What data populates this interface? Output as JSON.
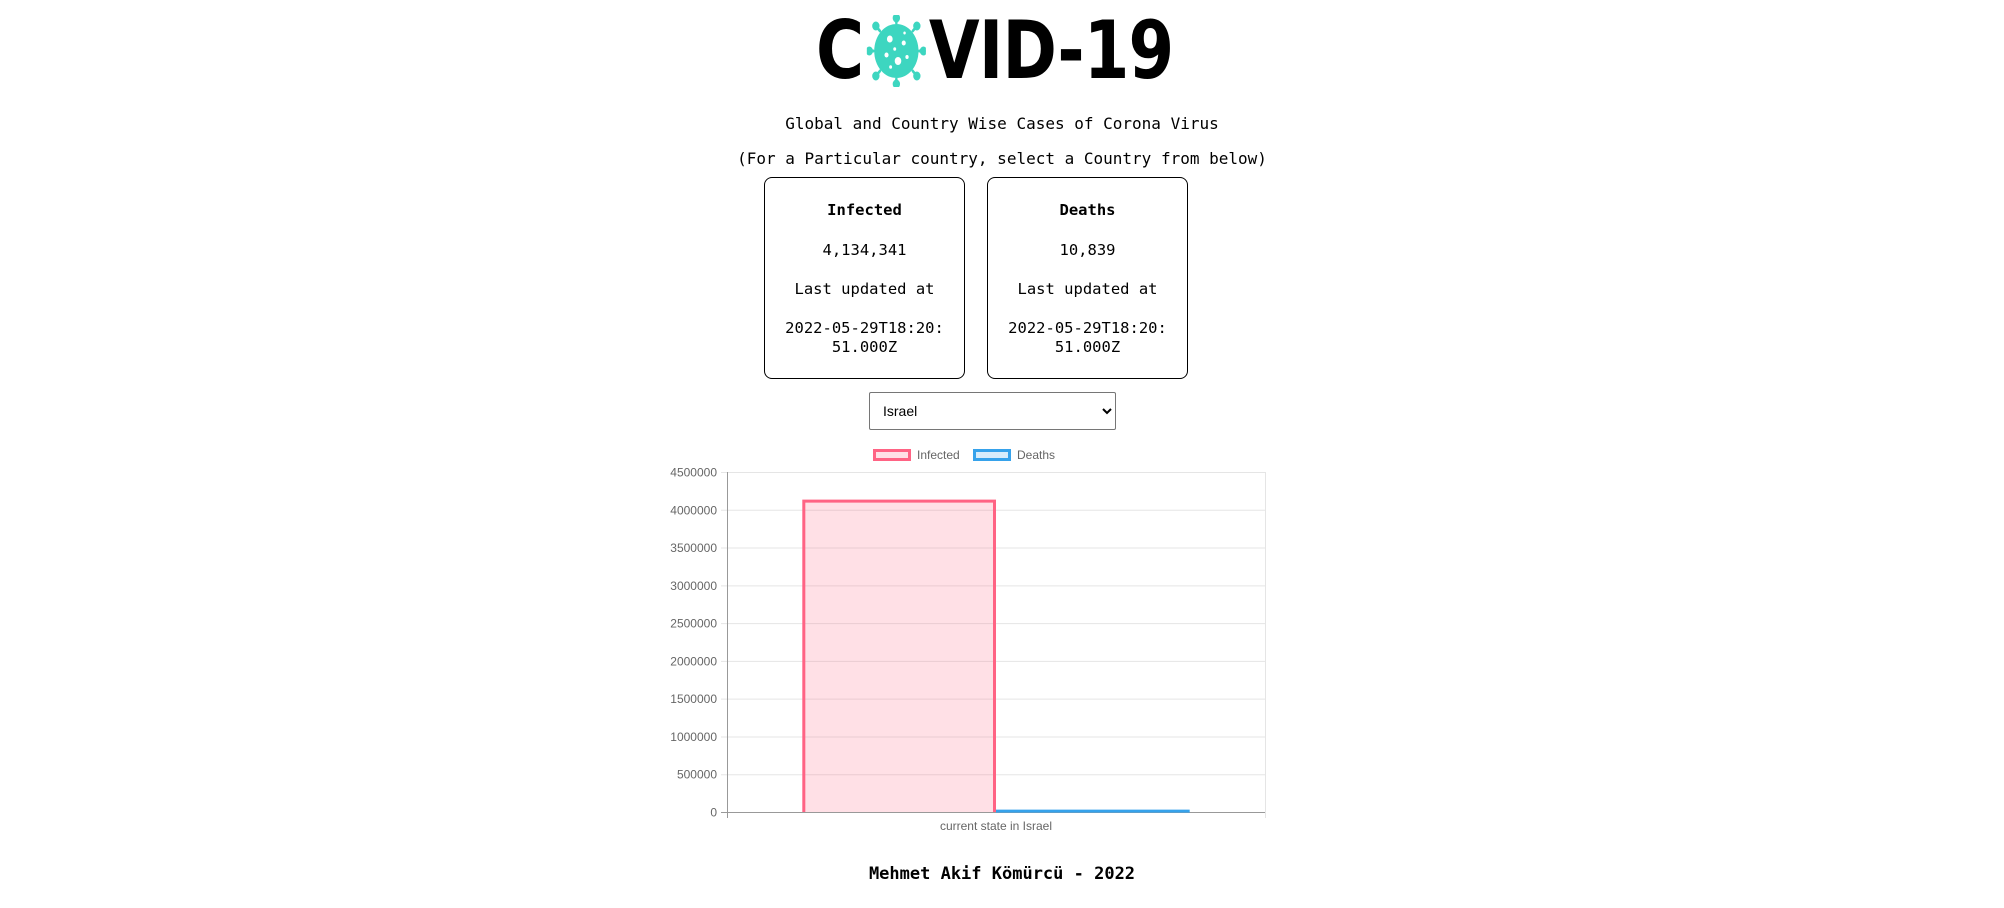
{
  "header": {
    "logo_left": "C",
    "logo_right": "VID-19",
    "subtitle": "Global and Country Wise Cases of Corona Virus",
    "instruction": "(For a Particular country, select a Country from below)"
  },
  "cards": [
    {
      "title": "Infected",
      "value": "4,134,341",
      "label": "Last updated at",
      "date": "2022-05-29T18:20:51.000Z"
    },
    {
      "title": "Deaths",
      "value": "10,839",
      "label": "Last updated at",
      "date": "2022-05-29T18:20:51.000Z"
    }
  ],
  "country_select": {
    "selected": "Israel"
  },
  "chart_data": {
    "type": "bar",
    "categories": [
      "current state in Israel"
    ],
    "series": [
      {
        "name": "Infected",
        "values": [
          4134341
        ],
        "color": "#ff6384"
      },
      {
        "name": "Deaths",
        "values": [
          10839
        ],
        "color": "#36a2eb"
      }
    ],
    "ylim": [
      0,
      4500000
    ],
    "yticks": [
      "4500000",
      "4000000",
      "3500000",
      "3000000",
      "2500000",
      "2000000",
      "1500000",
      "1000000",
      "500000",
      "0"
    ],
    "legend_position": "top",
    "grid": true
  },
  "footer": {
    "text": "Mehmet Akif Kömürcü - 2022"
  },
  "colors": {
    "virus": "#3dd6c0",
    "infected": "#ff6384",
    "deaths": "#36a2eb"
  }
}
